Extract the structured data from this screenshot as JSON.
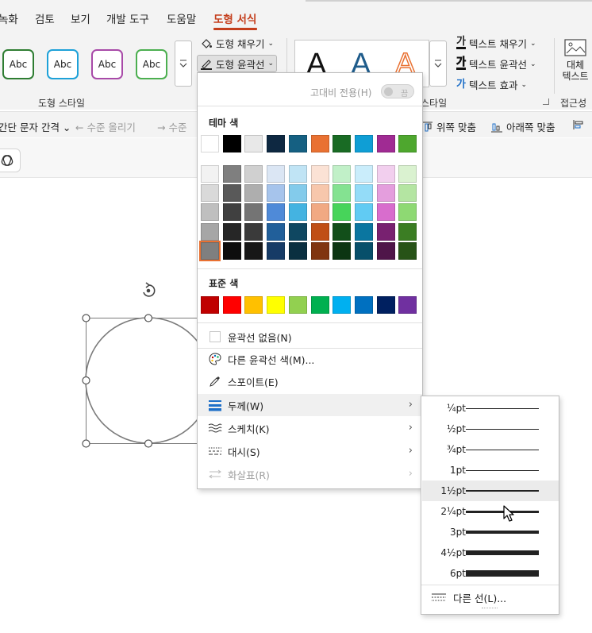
{
  "tabs": [
    {
      "label": "녹화",
      "active": false
    },
    {
      "label": "검토",
      "active": false
    },
    {
      "label": "보기",
      "active": false
    },
    {
      "label": "개발 도구",
      "active": false
    },
    {
      "label": "도움말",
      "active": false
    },
    {
      "label": "도형 서식",
      "active": true
    }
  ],
  "ribbon": {
    "style_swatch_text": "Abc",
    "style_swatches": [
      {
        "color": "#2e7d32"
      },
      {
        "color": "#1ea1d8"
      },
      {
        "color": "#a84aa8"
      },
      {
        "color": "#4caf50"
      }
    ],
    "shape_styles_label": "도형 스타일",
    "shape_fill_label": "도형 채우기",
    "shape_outline_label": "도형 윤곽선",
    "wordart_label": "스타일",
    "wordart_letter": "A",
    "text_fill_label": "텍스트 채우기",
    "text_outline_label": "텍스트 윤곽선",
    "text_effects_label": "텍스트 효과",
    "alt_text_line1": "대체",
    "alt_text_line2": "텍스트",
    "accessibility_label": "접근성",
    "text_fill_icon": "가",
    "text_outline_icon": "가",
    "text_effects_icon": "가"
  },
  "row2": {
    "char_spacing": "간단 문자 간격",
    "promote": "수준 올리기",
    "demote": "수준",
    "align_top": "위쪽 맞춤",
    "align_bottom": "아래쪽 맞춤"
  },
  "color_menu": {
    "high_contrast_label": "고대비 전용(H)",
    "toggle_text": "끔",
    "theme_colors_header": "테마 색",
    "theme_colors": [
      "#ffffff",
      "#000000",
      "#e8e8e8",
      "#0e2841",
      "#156082",
      "#e97132",
      "#196b24",
      "#0f9ed5",
      "#a02b93",
      "#4ea72e"
    ],
    "theme_tints": [
      [
        "#f2f2f2",
        "#7f7f7f",
        "#d0d0d0",
        "#dbe6f4",
        "#c0e4f5",
        "#fbe2d5",
        "#c1f0c8",
        "#caedfb",
        "#f2cfee",
        "#daf2d0"
      ],
      [
        "#d9d9d9",
        "#595959",
        "#aeaeae",
        "#a6c4ec",
        "#83cbeb",
        "#f7c7ac",
        "#84e291",
        "#94dcf8",
        "#e49edd",
        "#b4e5a2"
      ],
      [
        "#bfbfbf",
        "#404040",
        "#747474",
        "#4f8ad8",
        "#44b3e1",
        "#f1a983",
        "#47d45a",
        "#61cbf3",
        "#d86dcd",
        "#8ed973"
      ],
      [
        "#a6a6a6",
        "#262626",
        "#3a3a3a",
        "#215f9a",
        "#0f4761",
        "#c04f15",
        "#124f1a",
        "#0b76a0",
        "#782170",
        "#3b7d23"
      ],
      [
        "#7f7f7f",
        "#0d0d0d",
        "#171717",
        "#163b66",
        "#0a2f40",
        "#803510",
        "#0c3512",
        "#074f6a",
        "#4f1549",
        "#275317"
      ]
    ],
    "standard_colors_header": "표준 색",
    "standard_colors": [
      "#c00000",
      "#ff0000",
      "#ffc000",
      "#ffff00",
      "#92d050",
      "#00b050",
      "#00b0f0",
      "#0070c0",
      "#002060",
      "#7030a0"
    ],
    "no_outline": "윤곽선 없음(N)",
    "more_outline_colors": "다른 윤곽선 색(M)...",
    "eyedropper": "스포이트(E)",
    "weight": "두께(W)",
    "sketched": "스케치(K)",
    "dashes": "대시(S)",
    "arrows": "화살표(R)"
  },
  "weight_menu": {
    "items": [
      {
        "label": "¼pt",
        "value": 0.25
      },
      {
        "label": "½pt",
        "value": 0.5
      },
      {
        "label": "¾pt",
        "value": 0.75
      },
      {
        "label": "1pt",
        "value": 1
      },
      {
        "label": "1½pt",
        "value": 1.5
      },
      {
        "label": "2¼pt",
        "value": 2.25
      },
      {
        "label": "3pt",
        "value": 3
      },
      {
        "label": "4½pt",
        "value": 4.5
      },
      {
        "label": "6pt",
        "value": 6
      }
    ],
    "selected": "1½pt",
    "more_lines": "다른 선(L)..."
  },
  "colors": {
    "accent": "#c43e1c",
    "ribbon_bg": "#f3f3f3",
    "selected_border": "#e97132"
  }
}
